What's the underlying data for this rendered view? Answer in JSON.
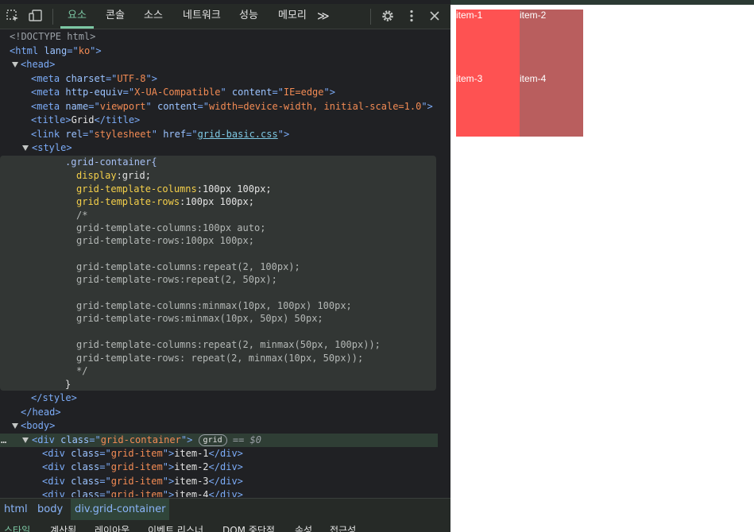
{
  "toolbar": {
    "tabs": [
      {
        "label": "요소",
        "active": true
      },
      {
        "label": "콘솔"
      },
      {
        "label": "소스"
      },
      {
        "label": "네트워크"
      },
      {
        "label": "성능"
      },
      {
        "label": "메모리"
      }
    ],
    "icons": [
      "inspect-icon",
      "device-toggle-icon",
      "more-tabs-icon",
      "settings-icon",
      "kebab-menu-icon",
      "close-icon"
    ],
    "more_glyph": "≫",
    "accent": "#7cc7a3"
  },
  "code": {
    "doctype": "<!DOCTYPE html>",
    "html_lang": "ko",
    "meta_charset": "UTF-8",
    "meta_httpequiv": "X-UA-Compatible",
    "meta_httpequiv_content": "IE=edge",
    "meta_name": "viewport",
    "meta_name_content": "width=device-width, initial-scale=1.0",
    "title_text": "Grid",
    "link_rel": "stylesheet",
    "link_href": "grid-basic.css",
    "css_selector": ".grid-container{",
    "css_display_prop": "display",
    "css_display_val": ":grid;",
    "css_cols_prop": "grid-template-columns",
    "css_cols_val": ":100px 100px;",
    "css_rows_prop": "grid-template-rows",
    "css_rows_val": ":100px 100px;",
    "comment_lines": [
      "/*",
      "grid-template-columns:100px auto;",
      "grid-template-rows:100px 100px;",
      "",
      "grid-template-columns:repeat(2, 100px);",
      "grid-template-rows:repeat(2, 50px);",
      "",
      "grid-template-columns:minmax(10px, 100px) 100px;",
      "grid-template-rows:minmax(10px, 50px) 50px;",
      "",
      "grid-template-columns:repeat(2, minmax(50px, 100px));",
      "grid-template-rows: repeat(2, minmax(10px, 50px));",
      "*/"
    ],
    "css_close": "}",
    "div_class": "grid-container",
    "grid_badge": "grid",
    "dollar_ref": "== $0",
    "child_class": "grid-item",
    "child_items": [
      "item-1",
      "item-2",
      "item-3",
      "item-4"
    ]
  },
  "breadcrumb": [
    "html",
    "body",
    "div.grid-container"
  ],
  "subtabs": [
    "스타일",
    "계산됨",
    "레이아웃",
    "이벤트 리스너",
    "DOM 중단점",
    "속성",
    "접근성"
  ],
  "preview": {
    "items": [
      {
        "label": "item-1",
        "color": "#fe5252"
      },
      {
        "label": "item-2",
        "color": "#b95e5e"
      },
      {
        "label": "item-3",
        "color": "#fe5252"
      },
      {
        "label": "item-4",
        "color": "#b95e5e"
      }
    ]
  }
}
